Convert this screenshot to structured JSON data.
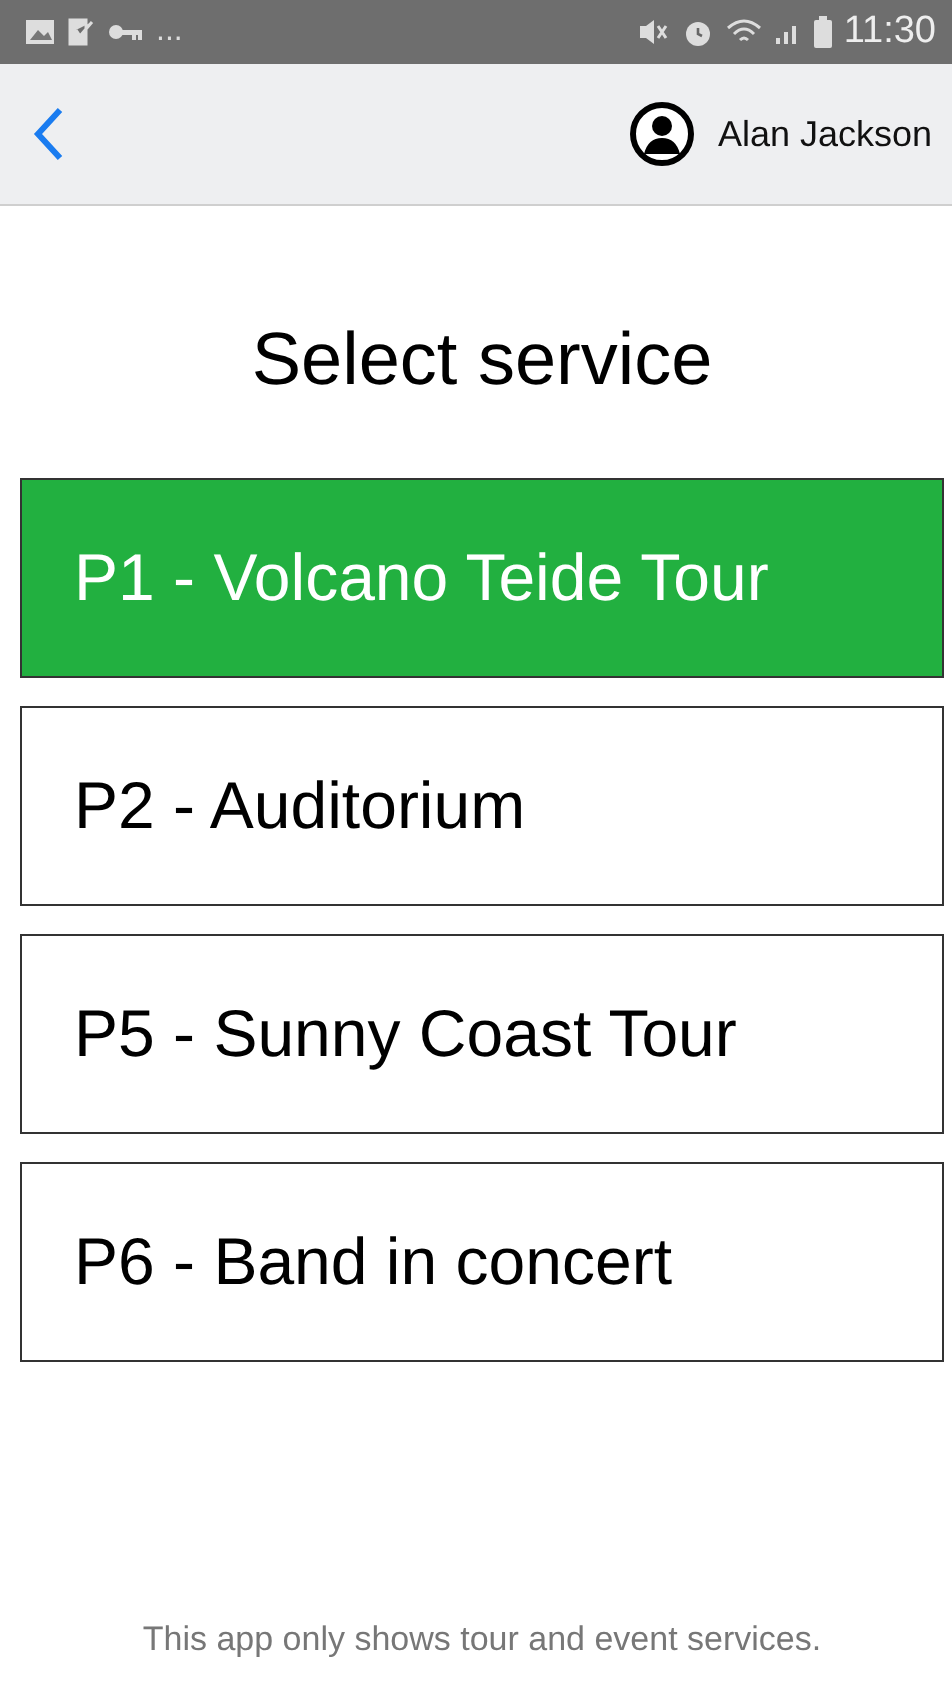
{
  "status_bar": {
    "overflow": "...",
    "time": "11:30"
  },
  "header": {
    "user_name": "Alan Jackson"
  },
  "title": "Select service",
  "services": [
    {
      "label": "P1 - Volcano Teide Tour",
      "selected": true
    },
    {
      "label": "P2 - Auditorium",
      "selected": false
    },
    {
      "label": "P5 - Sunny Coast Tour",
      "selected": false
    },
    {
      "label": "P6 - Band in concert",
      "selected": false
    }
  ],
  "footer_note": "This app only shows tour and event services."
}
